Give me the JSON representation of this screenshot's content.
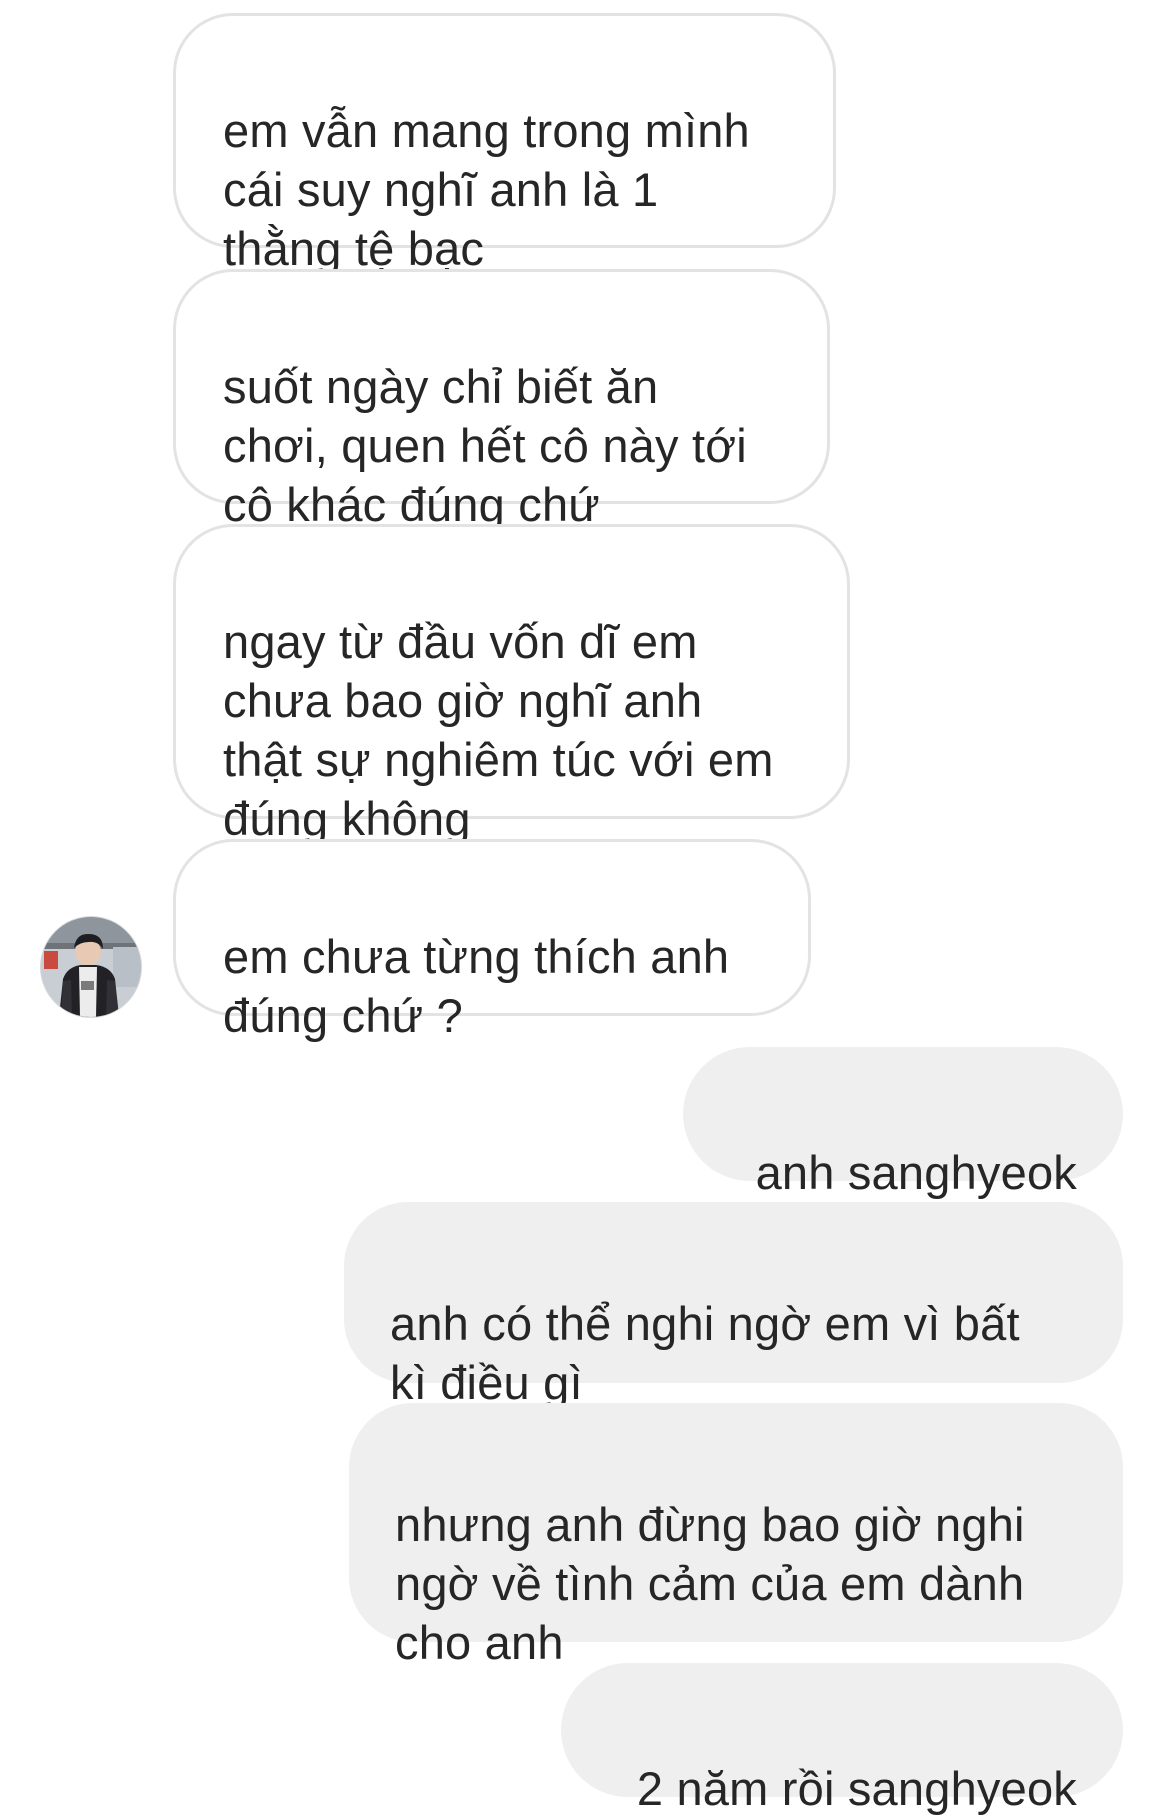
{
  "conversation": {
    "received": [
      {
        "text": "em vẫn mang trong mình\ncái suy nghĩ anh là 1\nthằng tệ bạc"
      },
      {
        "text": "suốt ngày chỉ biết ăn\nchơi, quen hết cô này tới\ncô khác đúng chứ"
      },
      {
        "text": "ngay từ đầu vốn dĩ em\nchưa bao giờ nghĩ anh\nthật sự nghiêm túc với em\nđúng không"
      },
      {
        "text": "em chưa từng thích anh\nđúng chứ ?"
      }
    ],
    "sent": [
      {
        "text": "anh sanghyeok"
      },
      {
        "text": "anh có thể nghi ngờ em vì bất\nkì điều gì"
      },
      {
        "text": "nhưng anh đừng bao giờ nghi\nngờ về tình cảm của em dành\ncho anh"
      },
      {
        "text": "2 năm rồi sanghyeok"
      }
    ]
  },
  "avatar": {
    "icon": "profile-photo-icon"
  },
  "colors": {
    "received_bubble_bg": "#ffffff",
    "received_bubble_border": "#e3e3e3",
    "sent_bubble_bg": "#efefef",
    "text": "#262626"
  }
}
